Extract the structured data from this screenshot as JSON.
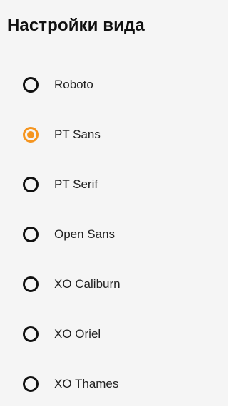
{
  "title": "Настройки вида",
  "accent_color": "#f5951f",
  "fonts": [
    {
      "label": "Roboto",
      "selected": false
    },
    {
      "label": "PT Sans",
      "selected": true
    },
    {
      "label": "PT Serif",
      "selected": false
    },
    {
      "label": "Open Sans",
      "selected": false
    },
    {
      "label": "XO Caliburn",
      "selected": false
    },
    {
      "label": "XO Oriel",
      "selected": false
    },
    {
      "label": "XO Thames",
      "selected": false
    }
  ]
}
